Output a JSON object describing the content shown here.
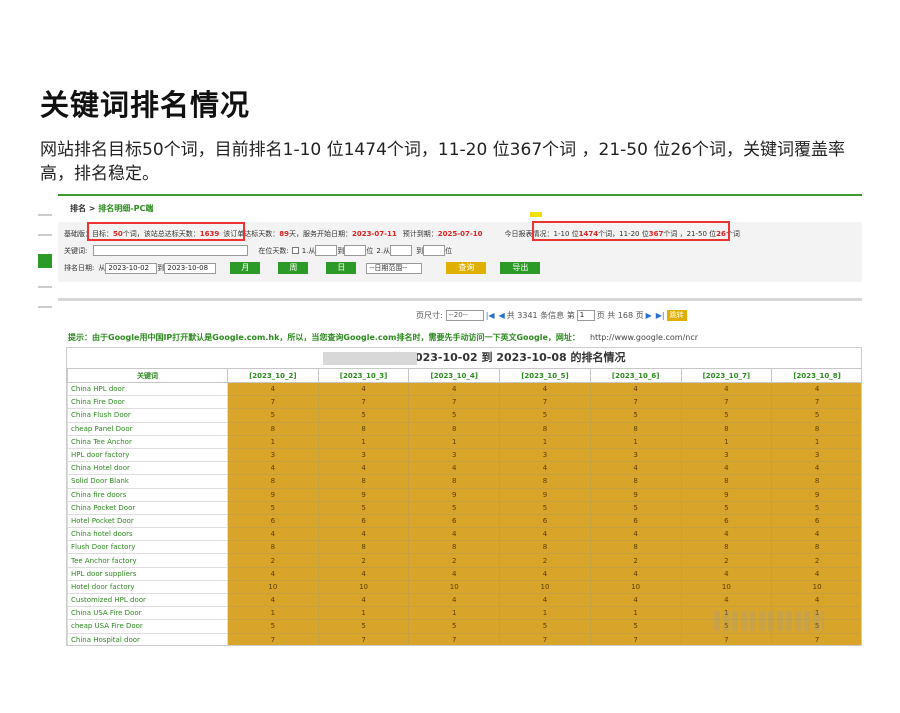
{
  "heading": "关键词排名情况",
  "description": "网站排名目标50个词，目前排名1-10 位1474个词，11-20 位367个词 ，21-50 位26个词，关键词覆盖率高，排名稳定。",
  "breadcrumb": {
    "root": "排名",
    "sep": " > ",
    "current": "排名明细-PC端"
  },
  "info": {
    "plan_label": "基础版：",
    "target_prefix": "目标：",
    "target_value": "50",
    "target_mid": " 个词，该站总达标天数：",
    "total_days": "1639",
    "sub_days_label": "该订单达标天数：",
    "sub_days": "89",
    "sub_days_unit": " 天，",
    "start_label": "服务开始日期：",
    "start_date": "2023-07-11",
    "expire_label": "预计到期：",
    "expire_date": "2025-07-10",
    "today_label": "今日报表情况：",
    "r1_prefix": "1-10 位 ",
    "r1_value": "1474",
    "r1_mid": " 个词，11-20 位 ",
    "r2_value": "367",
    "r2_mid": " 个词 ，21-50 位 ",
    "r3_value": "26",
    "r3_unit": " 个词"
  },
  "filters": {
    "keyword_label": "关键词:",
    "pos_days_label": "在位天数:",
    "opt1_from": "1.从",
    "to": "到",
    "unit_pos": "位",
    "opt2_from": "2.从",
    "date_label": "排名日期:",
    "from": "从",
    "date_from": "2023-10-02",
    "date_to": "2023-10-08",
    "btn_month": "月",
    "btn_week": "周",
    "btn_day": "日",
    "range_select": "--日期范围--",
    "btn_query": "查询",
    "btn_export": "导出"
  },
  "pager": {
    "page_size_label": "页尺寸:",
    "page_size_value": "--20--",
    "total_text": "共 3341 条信息 第",
    "page_value": "1",
    "pages_text": "页 共 168 页",
    "jump": "跳转"
  },
  "hint": {
    "text": "提示：由于Google用中国IP打开默认是Google.com.hk，所以，当您查询Google.com排名时，需要先手动访问一下英文Google，网址：",
    "url": "http://www.google.com/ncr"
  },
  "table": {
    "caption": "从 2023-10-02 到 2023-10-08 的排名情况",
    "headers": [
      "关键词",
      "[2023_10_2]",
      "[2023_10_3]",
      "[2023_10_4]",
      "[2023_10_5]",
      "[2023_10_6]",
      "[2023_10_7]",
      "[2023_10_8]"
    ],
    "rows": [
      {
        "kw": "China HPL door",
        "rank": "4"
      },
      {
        "kw": "China Fire Door",
        "rank": "7"
      },
      {
        "kw": "China Flush Door",
        "rank": "5"
      },
      {
        "kw": "cheap Panel Door",
        "rank": "8"
      },
      {
        "kw": "China Tee Anchor",
        "rank": "1"
      },
      {
        "kw": "HPL door factory",
        "rank": "3"
      },
      {
        "kw": "China Hotel door",
        "rank": "4"
      },
      {
        "kw": "Solid Door Blank",
        "rank": "8"
      },
      {
        "kw": "China fire doors",
        "rank": "9"
      },
      {
        "kw": "China Pocket Door",
        "rank": "5"
      },
      {
        "kw": "Hotel Pocket Door",
        "rank": "6"
      },
      {
        "kw": "China hotel doors",
        "rank": "4"
      },
      {
        "kw": "Flush Door factory",
        "rank": "8"
      },
      {
        "kw": "Tee Anchor factory",
        "rank": "2"
      },
      {
        "kw": "HPL door suppliers",
        "rank": "4"
      },
      {
        "kw": "Hotel door factory",
        "rank": "10"
      },
      {
        "kw": "Customized HPL door",
        "rank": "4"
      },
      {
        "kw": "China USA Fire Door",
        "rank": "1"
      },
      {
        "kw": "cheap USA Fire Door",
        "rank": "5"
      },
      {
        "kw": "China Hospital door",
        "rank": "7"
      }
    ]
  }
}
